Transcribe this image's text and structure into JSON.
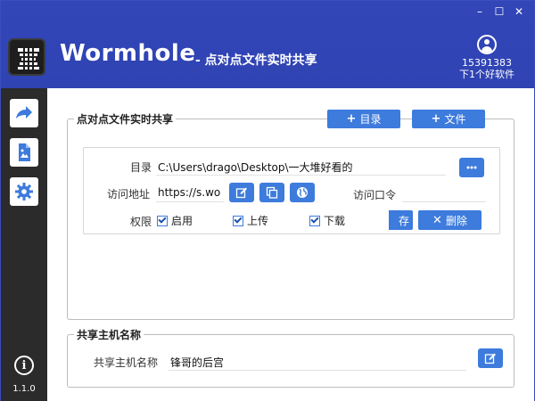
{
  "app": {
    "title": "Wormhole",
    "subtitle": "- 点对点文件实时共享"
  },
  "window_controls": {
    "minimize": "–",
    "maximize": "☐",
    "close": "✕"
  },
  "user": {
    "id": "15391383",
    "name": "下1个好软件"
  },
  "sidebar": {
    "items": [
      {
        "name": "share",
        "icon": "share-arrow-icon",
        "active": true
      },
      {
        "name": "file",
        "icon": "file-image-icon",
        "active": false
      },
      {
        "name": "settings",
        "icon": "gear-icon",
        "active": false
      }
    ],
    "info_icon": "i",
    "version": "1.1.0"
  },
  "share_group": {
    "title": "点对点文件实时共享",
    "add_dir_label": "目录",
    "add_file_label": "文件",
    "entry": {
      "dir_label": "目录",
      "dir_value": "C:\\Users\\drago\\Desktop\\一大堆好看的",
      "addr_label": "访问地址",
      "addr_value": "https://s.wo",
      "password_label": "访问口令",
      "password_value": "",
      "perm_label": "权限",
      "perm_enable": "启用",
      "perm_upload": "上传",
      "perm_download": "下载",
      "save_label": "存",
      "delete_label": "删除"
    }
  },
  "host_group": {
    "title": "共享主机名称",
    "label": "共享主机名称",
    "value": "锋哥的后宫"
  },
  "colors": {
    "header": "#3246b8",
    "sidebar": "#2b2b2b",
    "accent": "#3d7bdc"
  }
}
